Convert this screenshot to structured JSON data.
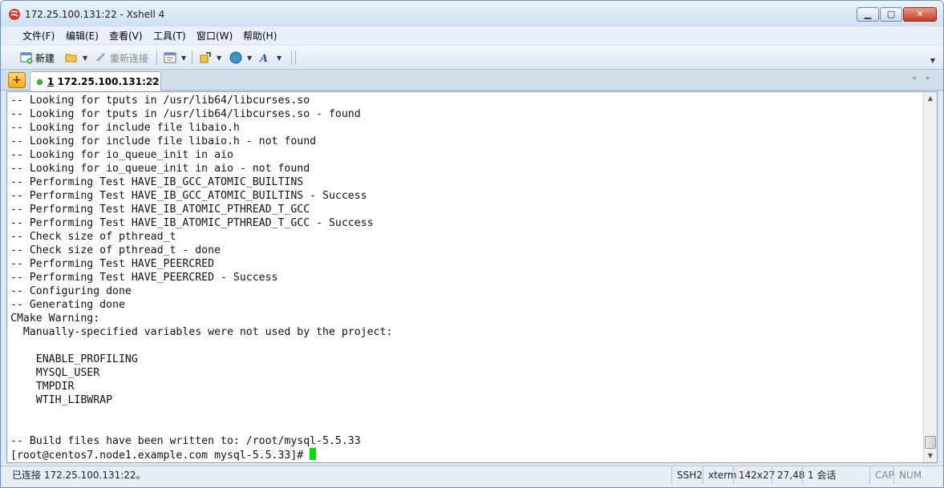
{
  "window": {
    "title": "172.25.100.131:22 - Xshell 4",
    "minimize": "▁",
    "maximize": "▢",
    "close": "✕"
  },
  "menu": {
    "items": [
      "文件(F)",
      "编辑(E)",
      "查看(V)",
      "工具(T)",
      "窗口(W)",
      "帮助(H)"
    ]
  },
  "toolbar": {
    "new_label": "新建",
    "reconnect_label": "重新连接"
  },
  "tabs": {
    "add": "+",
    "active_number": "1",
    "active_label": "172.25.100.131:22",
    "close": "×",
    "nav_left": "◂",
    "nav_right": "▸"
  },
  "terminal": {
    "lines": [
      "-- Looking for tputs in /usr/lib64/libcurses.so",
      "-- Looking for tputs in /usr/lib64/libcurses.so - found",
      "-- Looking for include file libaio.h",
      "-- Looking for include file libaio.h - not found",
      "-- Looking for io_queue_init in aio",
      "-- Looking for io_queue_init in aio - not found",
      "-- Performing Test HAVE_IB_GCC_ATOMIC_BUILTINS",
      "-- Performing Test HAVE_IB_GCC_ATOMIC_BUILTINS - Success",
      "-- Performing Test HAVE_IB_ATOMIC_PTHREAD_T_GCC",
      "-- Performing Test HAVE_IB_ATOMIC_PTHREAD_T_GCC - Success",
      "-- Check size of pthread_t",
      "-- Check size of pthread_t - done",
      "-- Performing Test HAVE_PEERCRED",
      "-- Performing Test HAVE_PEERCRED - Success",
      "-- Configuring done",
      "-- Generating done",
      "CMake Warning:",
      "  Manually-specified variables were not used by the project:",
      "",
      "    ENABLE_PROFILING",
      "    MYSQL_USER",
      "    TMPDIR",
      "    WTIH_LIBWRAP",
      "",
      "",
      "-- Build files have been written to: /root/mysql-5.5.33"
    ],
    "prompt": "[root@centos7.node1.example.com mysql-5.5.33]# "
  },
  "status": {
    "connection": "已连接 172.25.100.131:22。",
    "protocol": "SSH2",
    "term": "xterm",
    "size": "142x27",
    "cursor_pos": "27,48",
    "sessions": "1 会话",
    "cap": "CAP",
    "num": "NUM"
  }
}
